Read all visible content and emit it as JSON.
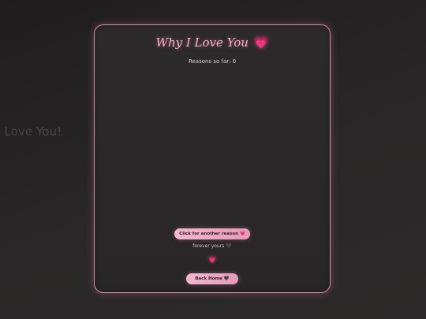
{
  "background": {
    "text": "I Love You!"
  },
  "card": {
    "title": "Why I Love You",
    "title_emoji": "💗",
    "counter_label": "Reasons so far: ",
    "counter_value": "0",
    "reason_text": "",
    "another_button_label": "Click for another reason",
    "another_button_emoji": "💗",
    "footer_text": "forever yours",
    "footer_emoji": "🖤",
    "floating_heart": "💗",
    "home_button_label": "Back Home",
    "home_button_emoji": "🖤"
  },
  "colors": {
    "accent_pink": "#f3b7ce",
    "border_pink": "#d98aa8",
    "heart_pink": "#ff4f8b",
    "background_dark": "#252223"
  },
  "icons": {
    "title_icon": "heart-icon",
    "button_icon": "heart-icon",
    "footer_icon": "black-heart-icon",
    "home_icon": "black-heart-icon"
  }
}
